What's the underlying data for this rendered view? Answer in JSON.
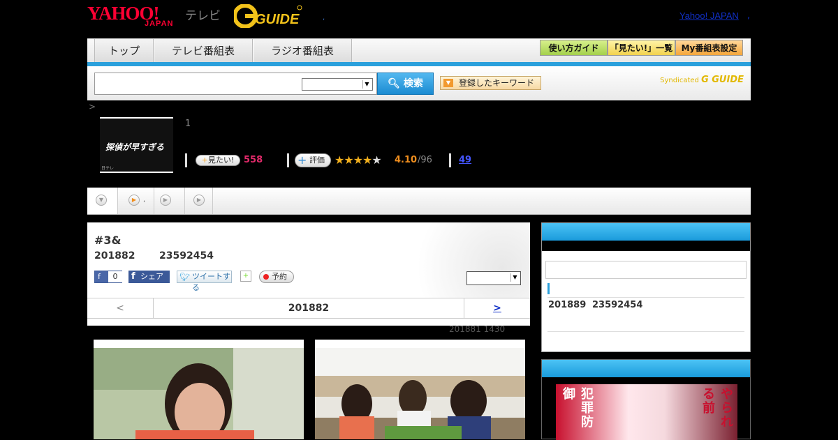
{
  "header": {
    "yahoo_logo": "YAHOO!",
    "japan_logo": "JAPAN",
    "tv_label": "テレビ",
    "gguide_logo": "G GUIDE",
    "dot": ",",
    "yahoo_japan_link": "Yahoo! JAPAN",
    "trailing_dot": ","
  },
  "nav": {
    "tabs": [
      "トップ",
      "テレビ番組表",
      "ラジオ番組表"
    ],
    "right_buttons": [
      "使い方ガイド",
      "「見たい!」一覧",
      "My番組表設定"
    ]
  },
  "search": {
    "input_value": "",
    "select_value": "",
    "button_label": "検索",
    "keyword_button": "登録したキーワード",
    "syndicated": "Syndicated",
    "syndicated_logo": "G GUIDE"
  },
  "breadcrumb": ">",
  "program": {
    "thumb_title": "探偵が早すぎる",
    "thumb_small": "日テレ",
    "episode_count": "1",
    "mitai_label": "見たい!",
    "mitai_count": "558",
    "hyoka_label": "評価",
    "stars": 4.1,
    "rating": "4.10",
    "rating_count": "/96",
    "comments": "49"
  },
  "subtabs": {
    "dot": ","
  },
  "episode": {
    "title": "#3&",
    "date": "201882",
    "id": "23592454",
    "fb_like": "0",
    "fb_share": "シェア",
    "tweet": "ツイートする",
    "yoyaku": "予約",
    "select_value": ""
  },
  "pager": {
    "prev": "<",
    "current": "201882",
    "next": ">"
  },
  "air_note": "201881  1430",
  "sidebar": {
    "date": "201889",
    "id": "23592454"
  },
  "poster": {
    "left_text": "犯罪防御",
    "right_text": "やられる前"
  },
  "colors": {
    "accent_blue": "#2aa0dc",
    "yahoo_red": "#ff0033",
    "rating_orange": "#f08e1e",
    "mitai_pink": "#e22a6a"
  }
}
